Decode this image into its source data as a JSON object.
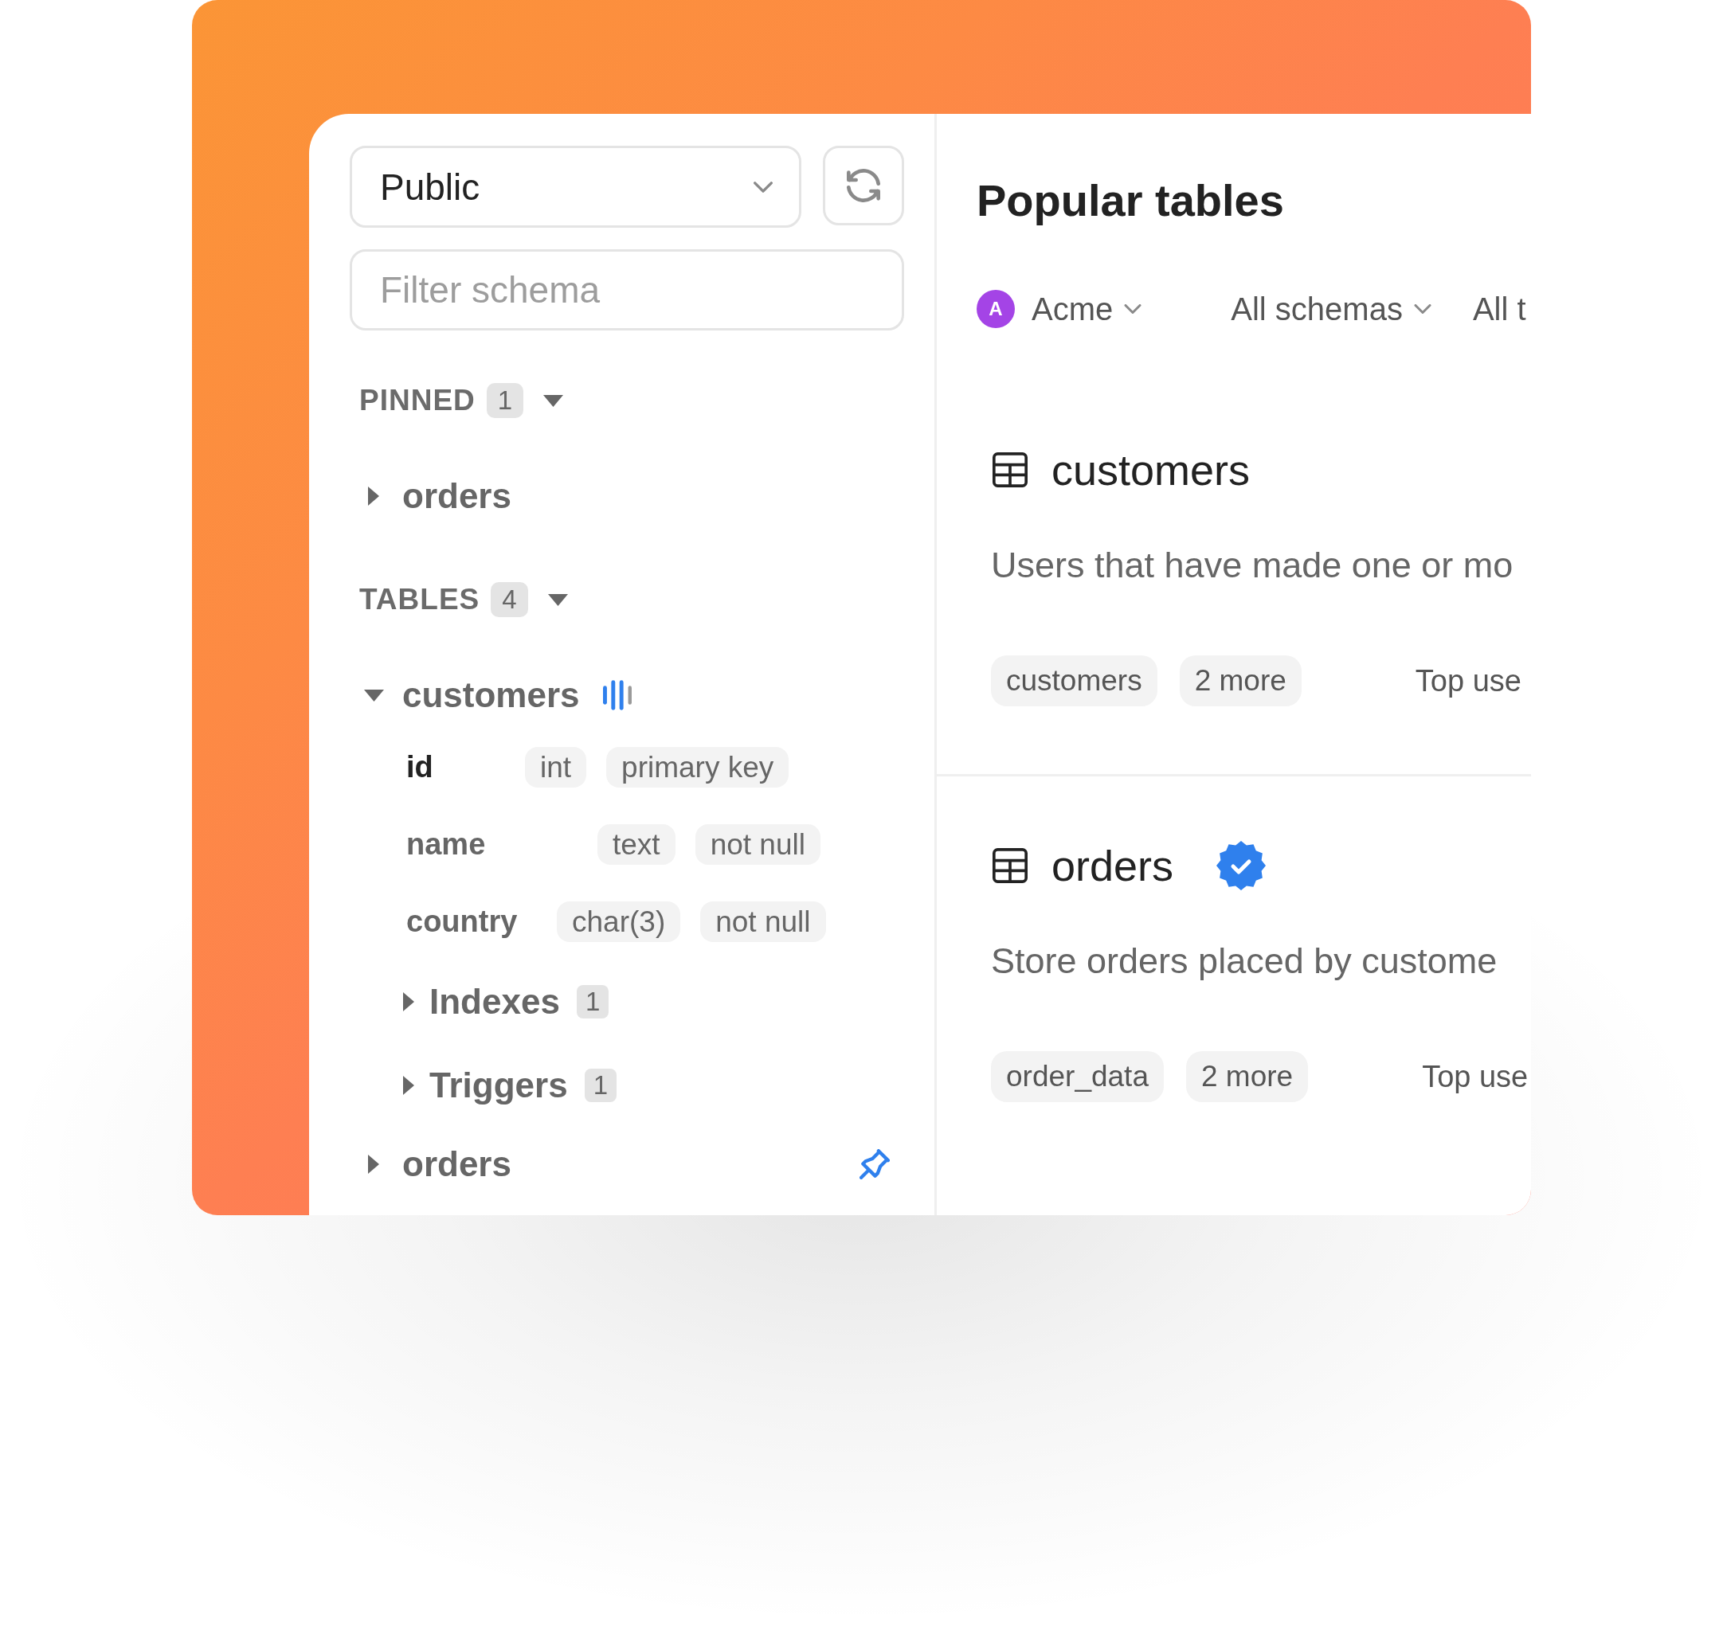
{
  "sidebar": {
    "schema_select": {
      "value": "Public"
    },
    "filter": {
      "placeholder": "Filter schema"
    },
    "sections": [
      {
        "title": "PINNED",
        "count": "1",
        "expanded": true,
        "items": [
          {
            "name": "orders",
            "expanded": false
          }
        ]
      },
      {
        "title": "TABLES",
        "count": "4",
        "expanded": true,
        "items": [
          {
            "name": "customers",
            "expanded": true,
            "activity": true,
            "pinned": false,
            "children": [
              {
                "kind": "column",
                "name": "id",
                "selected": true,
                "tags": [
                  "int",
                  "primary key"
                ]
              },
              {
                "kind": "column",
                "name": "name",
                "selected": false,
                "tags": [
                  "text",
                  "not null"
                ]
              },
              {
                "kind": "column",
                "name": "country",
                "selected": false,
                "tags": [
                  "char(3)",
                  "not null"
                ]
              },
              {
                "kind": "group",
                "name": "Indexes",
                "count": "1",
                "expanded": false
              },
              {
                "kind": "group",
                "name": "Triggers",
                "count": "1",
                "expanded": false
              }
            ]
          },
          {
            "name": "orders",
            "expanded": false,
            "activity": false,
            "pinned": true
          }
        ]
      }
    ]
  },
  "main": {
    "title": "Popular tables",
    "filters": [
      {
        "kind": "dropdown",
        "label": "Acme",
        "avatar": "A"
      },
      {
        "kind": "dropdown",
        "label": "All schemas"
      },
      {
        "kind": "label",
        "label": "All t"
      }
    ],
    "cards": [
      {
        "title": "customers",
        "verified": false,
        "description": "Users that have made one or mo",
        "tags": [
          "customers"
        ],
        "more": "2 more",
        "top_users": "Top use"
      },
      {
        "title": "orders",
        "verified": true,
        "description": "Store orders placed by custome",
        "tags": [
          "order_data"
        ],
        "more": "2 more",
        "top_users": "Top use"
      }
    ]
  }
}
